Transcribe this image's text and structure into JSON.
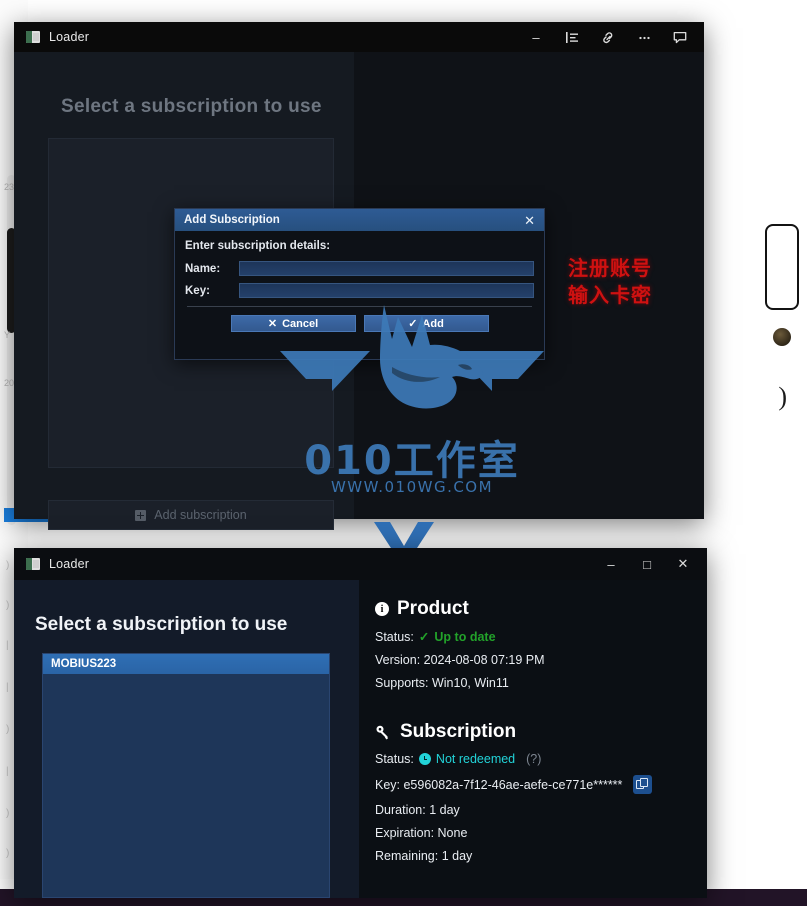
{
  "background": {
    "ticks": [
      "23",
      "Y",
      "20"
    ],
    "left_marks": [
      ")",
      ")",
      "|",
      "|",
      ")",
      "|",
      ")",
      ")",
      "|"
    ],
    "right_paren": ")"
  },
  "top_window": {
    "title": "Loader",
    "app_icon": "app-icon",
    "titlebar_buttons": [
      {
        "name": "minimize-button",
        "glyph": "–"
      }
    ],
    "overlay_icons": [
      {
        "name": "list-format-icon"
      },
      {
        "name": "link-icon"
      },
      {
        "name": "ellipsis-icon"
      },
      {
        "name": "comment-icon"
      }
    ],
    "heading": "Select a subscription to use",
    "add_subscription_label": "Add subscription"
  },
  "dialog": {
    "title": "Add Subscription",
    "close_glyph": "✕",
    "subtitle": "Enter subscription details:",
    "fields": [
      {
        "label": "Name:",
        "value": "",
        "placeholder": ""
      },
      {
        "label": "Key:",
        "value": "",
        "placeholder": ""
      }
    ],
    "cancel_label": "Cancel",
    "cancel_glyph": "✕",
    "add_label": "Add",
    "add_glyph": "✓"
  },
  "annotations": {
    "chinese_note_line1": "注册账号",
    "chinese_note_line2": "输入卡密",
    "note_color": "#cf1111",
    "arrow": "down-arrow-annotation",
    "arrow_color": "#2f6fb5"
  },
  "watermark": {
    "logo": "wolf-head-logo",
    "studio_text": "010工作室",
    "url_text": "WWW.010WG.COM",
    "color": "#3d7ab8"
  },
  "bottom_window": {
    "title": "Loader",
    "titlebar_buttons": [
      {
        "name": "minimize-button",
        "glyph": "–"
      },
      {
        "name": "maximize-button",
        "glyph": "□"
      },
      {
        "name": "close-button",
        "glyph": "✕"
      }
    ],
    "heading": "Select a subscription to use",
    "subscriptions": [
      {
        "name": "MOBIUS223",
        "selected": true
      }
    ],
    "product": {
      "section_title": "Product",
      "section_icon": "info-icon",
      "status_label": "Status:",
      "status_value": "Up to date",
      "status_check": "✓",
      "status_color": "#22a22a",
      "version_line": "Version: 2024-08-08 07:19 PM",
      "supports_line": "Supports: Win10, Win11"
    },
    "subscription": {
      "section_title": "Subscription",
      "section_icon": "key-icon",
      "status_label": "Status:",
      "status_value": "Not redeemed",
      "status_color": "#22d3d8",
      "status_help": "(?)",
      "key_line": "Key: e596082a-7f12-46ae-aefe-ce771e******",
      "copy_icon": "copy-icon",
      "duration_line": "Duration: 1 day",
      "expiration_line": "Expiration: None",
      "remaining_line": "Remaining: 1 day"
    }
  }
}
